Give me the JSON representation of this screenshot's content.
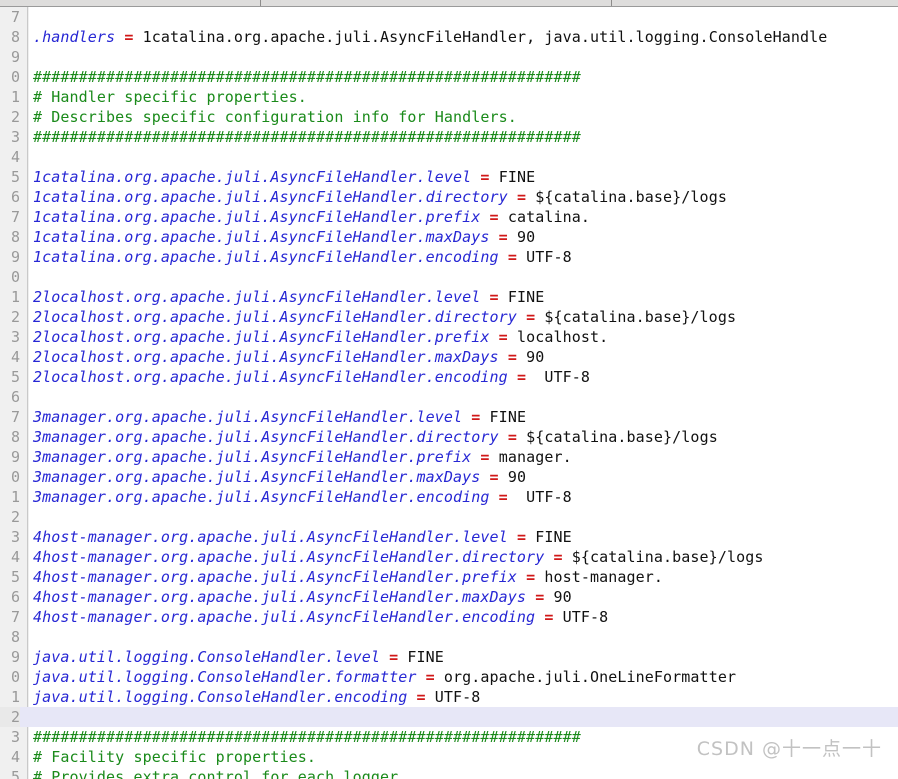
{
  "watermark": {
    "text": "CSDN @十一点一十"
  },
  "colors": {
    "comment": "#1a8a1a",
    "key": "#2727d4",
    "equals": "#d01818",
    "value": "#111111",
    "gutter_bg": "#f0f0f0",
    "gutter_fg": "#999999",
    "current_line_bg": "#e7e7f7",
    "editor_bg": "#ffffff"
  },
  "editor": {
    "gutter_note": "line numbers are clipped at the left edge; only the final digit is visible",
    "lines": [
      {
        "num": "7",
        "highlight": false,
        "tokens": []
      },
      {
        "num": "8",
        "highlight": false,
        "tokens": [
          {
            "t": "key",
            "s": ".handlers "
          },
          {
            "t": "eq",
            "s": "="
          },
          {
            "t": "val",
            "s": " 1catalina.org.apache.juli.AsyncFileHandler, java.util.logging.ConsoleHandle"
          }
        ]
      },
      {
        "num": "9",
        "highlight": false,
        "tokens": []
      },
      {
        "num": "0",
        "highlight": false,
        "tokens": [
          {
            "t": "comment",
            "s": "############################################################"
          }
        ]
      },
      {
        "num": "1",
        "highlight": false,
        "tokens": [
          {
            "t": "comment",
            "s": "# Handler specific properties."
          }
        ]
      },
      {
        "num": "2",
        "highlight": false,
        "tokens": [
          {
            "t": "comment",
            "s": "# Describes specific configuration info for Handlers."
          }
        ]
      },
      {
        "num": "3",
        "highlight": false,
        "tokens": [
          {
            "t": "comment",
            "s": "############################################################"
          }
        ]
      },
      {
        "num": "4",
        "highlight": false,
        "tokens": []
      },
      {
        "num": "5",
        "highlight": false,
        "tokens": [
          {
            "t": "key",
            "s": "1catalina.org.apache.juli.AsyncFileHandler.level "
          },
          {
            "t": "eq",
            "s": "="
          },
          {
            "t": "val",
            "s": " FINE"
          }
        ]
      },
      {
        "num": "6",
        "highlight": false,
        "tokens": [
          {
            "t": "key",
            "s": "1catalina.org.apache.juli.AsyncFileHandler.directory "
          },
          {
            "t": "eq",
            "s": "="
          },
          {
            "t": "val",
            "s": " ${catalina.base}/logs"
          }
        ]
      },
      {
        "num": "7",
        "highlight": false,
        "tokens": [
          {
            "t": "key",
            "s": "1catalina.org.apache.juli.AsyncFileHandler.prefix "
          },
          {
            "t": "eq",
            "s": "="
          },
          {
            "t": "val",
            "s": " catalina."
          }
        ]
      },
      {
        "num": "8",
        "highlight": false,
        "tokens": [
          {
            "t": "key",
            "s": "1catalina.org.apache.juli.AsyncFileHandler.maxDays "
          },
          {
            "t": "eq",
            "s": "="
          },
          {
            "t": "val",
            "s": " 90"
          }
        ]
      },
      {
        "num": "9",
        "highlight": false,
        "tokens": [
          {
            "t": "key",
            "s": "1catalina.org.apache.juli.AsyncFileHandler.encoding "
          },
          {
            "t": "eq",
            "s": "="
          },
          {
            "t": "val",
            "s": " UTF-8"
          }
        ]
      },
      {
        "num": "0",
        "highlight": false,
        "tokens": []
      },
      {
        "num": "1",
        "highlight": false,
        "tokens": [
          {
            "t": "key",
            "s": "2localhost.org.apache.juli.AsyncFileHandler.level "
          },
          {
            "t": "eq",
            "s": "="
          },
          {
            "t": "val",
            "s": " FINE"
          }
        ]
      },
      {
        "num": "2",
        "highlight": false,
        "tokens": [
          {
            "t": "key",
            "s": "2localhost.org.apache.juli.AsyncFileHandler.directory "
          },
          {
            "t": "eq",
            "s": "="
          },
          {
            "t": "val",
            "s": " ${catalina.base}/logs"
          }
        ]
      },
      {
        "num": "3",
        "highlight": false,
        "tokens": [
          {
            "t": "key",
            "s": "2localhost.org.apache.juli.AsyncFileHandler.prefix "
          },
          {
            "t": "eq",
            "s": "="
          },
          {
            "t": "val",
            "s": " localhost."
          }
        ]
      },
      {
        "num": "4",
        "highlight": false,
        "tokens": [
          {
            "t": "key",
            "s": "2localhost.org.apache.juli.AsyncFileHandler.maxDays "
          },
          {
            "t": "eq",
            "s": "="
          },
          {
            "t": "val",
            "s": " 90"
          }
        ]
      },
      {
        "num": "5",
        "highlight": false,
        "tokens": [
          {
            "t": "key",
            "s": "2localhost.org.apache.juli.AsyncFileHandler.encoding "
          },
          {
            "t": "eq",
            "s": "="
          },
          {
            "t": "val",
            "s": "  UTF-8"
          }
        ]
      },
      {
        "num": "6",
        "highlight": false,
        "tokens": []
      },
      {
        "num": "7",
        "highlight": false,
        "tokens": [
          {
            "t": "key",
            "s": "3manager.org.apache.juli.AsyncFileHandler.level "
          },
          {
            "t": "eq",
            "s": "="
          },
          {
            "t": "val",
            "s": " FINE"
          }
        ]
      },
      {
        "num": "8",
        "highlight": false,
        "tokens": [
          {
            "t": "key",
            "s": "3manager.org.apache.juli.AsyncFileHandler.directory "
          },
          {
            "t": "eq",
            "s": "="
          },
          {
            "t": "val",
            "s": " ${catalina.base}/logs"
          }
        ]
      },
      {
        "num": "9",
        "highlight": false,
        "tokens": [
          {
            "t": "key",
            "s": "3manager.org.apache.juli.AsyncFileHandler.prefix "
          },
          {
            "t": "eq",
            "s": "="
          },
          {
            "t": "val",
            "s": " manager."
          }
        ]
      },
      {
        "num": "0",
        "highlight": false,
        "tokens": [
          {
            "t": "key",
            "s": "3manager.org.apache.juli.AsyncFileHandler.maxDays "
          },
          {
            "t": "eq",
            "s": "="
          },
          {
            "t": "val",
            "s": " 90"
          }
        ]
      },
      {
        "num": "1",
        "highlight": false,
        "tokens": [
          {
            "t": "key",
            "s": "3manager.org.apache.juli.AsyncFileHandler.encoding "
          },
          {
            "t": "eq",
            "s": "="
          },
          {
            "t": "val",
            "s": "  UTF-8"
          }
        ]
      },
      {
        "num": "2",
        "highlight": false,
        "tokens": []
      },
      {
        "num": "3",
        "highlight": false,
        "tokens": [
          {
            "t": "key",
            "s": "4host-manager.org.apache.juli.AsyncFileHandler.level "
          },
          {
            "t": "eq",
            "s": "="
          },
          {
            "t": "val",
            "s": " FINE"
          }
        ]
      },
      {
        "num": "4",
        "highlight": false,
        "tokens": [
          {
            "t": "key",
            "s": "4host-manager.org.apache.juli.AsyncFileHandler.directory "
          },
          {
            "t": "eq",
            "s": "="
          },
          {
            "t": "val",
            "s": " ${catalina.base}/logs"
          }
        ]
      },
      {
        "num": "5",
        "highlight": false,
        "tokens": [
          {
            "t": "key",
            "s": "4host-manager.org.apache.juli.AsyncFileHandler.prefix "
          },
          {
            "t": "eq",
            "s": "="
          },
          {
            "t": "val",
            "s": " host-manager."
          }
        ]
      },
      {
        "num": "6",
        "highlight": false,
        "tokens": [
          {
            "t": "key",
            "s": "4host-manager.org.apache.juli.AsyncFileHandler.maxDays "
          },
          {
            "t": "eq",
            "s": "="
          },
          {
            "t": "val",
            "s": " 90"
          }
        ]
      },
      {
        "num": "7",
        "highlight": false,
        "tokens": [
          {
            "t": "key",
            "s": "4host-manager.org.apache.juli.AsyncFileHandler.encoding "
          },
          {
            "t": "eq",
            "s": "="
          },
          {
            "t": "val",
            "s": " UTF-8"
          }
        ]
      },
      {
        "num": "8",
        "highlight": false,
        "tokens": []
      },
      {
        "num": "9",
        "highlight": false,
        "tokens": [
          {
            "t": "key",
            "s": "java.util.logging.ConsoleHandler.level "
          },
          {
            "t": "eq",
            "s": "="
          },
          {
            "t": "val",
            "s": " FINE"
          }
        ]
      },
      {
        "num": "0",
        "highlight": false,
        "tokens": [
          {
            "t": "key",
            "s": "java.util.logging.ConsoleHandler.formatter "
          },
          {
            "t": "eq",
            "s": "="
          },
          {
            "t": "val",
            "s": " org.apache.juli.OneLineFormatter"
          }
        ]
      },
      {
        "num": "1",
        "highlight": false,
        "tokens": [
          {
            "t": "key",
            "s": "java.util.logging.ConsoleHandler.encoding "
          },
          {
            "t": "eq",
            "s": "="
          },
          {
            "t": "val",
            "s": " UTF-8"
          }
        ]
      },
      {
        "num": "2",
        "highlight": true,
        "tokens": []
      },
      {
        "num": "3",
        "highlight": false,
        "tokens": [
          {
            "t": "comment",
            "s": "############################################################"
          }
        ]
      },
      {
        "num": "4",
        "highlight": false,
        "tokens": [
          {
            "t": "comment",
            "s": "# Facility specific properties."
          }
        ]
      },
      {
        "num": "5",
        "highlight": false,
        "tokens": [
          {
            "t": "comment",
            "s": "# Provides extra control for each logger."
          }
        ]
      }
    ]
  }
}
